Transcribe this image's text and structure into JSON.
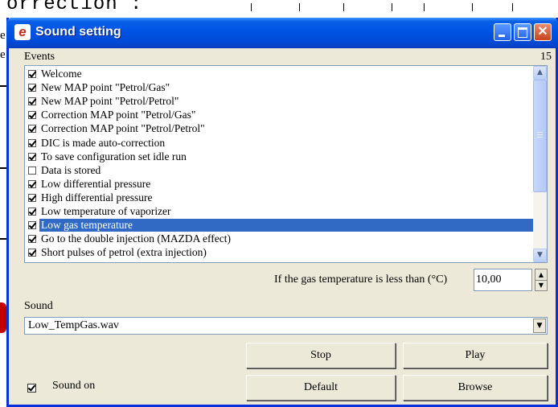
{
  "background": {
    "fragment_text": "orrection :",
    "left_letters": [
      "e",
      "e"
    ]
  },
  "window": {
    "title": "Sound setting",
    "app_icon_letter": "e",
    "controls": {
      "close_glyph": "✕"
    }
  },
  "events": {
    "label": "Events",
    "count": "15",
    "items": [
      {
        "label": "Welcome",
        "checked": true
      },
      {
        "label": "New MAP point \"Petrol/Gas\"",
        "checked": true
      },
      {
        "label": "New MAP point \"Petrol/Petrol\"",
        "checked": true
      },
      {
        "label": "Correction MAP point \"Petrol/Gas\"",
        "checked": true
      },
      {
        "label": "Correction MAP point \"Petrol/Petrol\"",
        "checked": true
      },
      {
        "label": "DIC is made auto-correction",
        "checked": true
      },
      {
        "label": "To save configuration set idle run",
        "checked": true
      },
      {
        "label": "Data is stored",
        "checked": false
      },
      {
        "label": "Low differential pressure",
        "checked": true
      },
      {
        "label": "High differential pressure",
        "checked": true
      },
      {
        "label": "Low temperature of vaporizer",
        "checked": true
      },
      {
        "label": "Low gas temperature",
        "checked": true,
        "selected": true
      },
      {
        "label": "Go to the double injection (MAZDA effect)",
        "checked": true
      },
      {
        "label": "Short pulses of petrol (extra injection)",
        "checked": true
      }
    ],
    "scroll_up_glyph": "▲",
    "scroll_down_glyph": "▼"
  },
  "condition": {
    "label": "If the gas temperature is less than (°C)",
    "value": "10,00",
    "spin_up": "▲",
    "spin_down": "▼"
  },
  "sound": {
    "label": "Sound",
    "selected_file": "Low_TempGas.wav",
    "dropdown_glyph": "▼"
  },
  "buttons": {
    "stop": "Stop",
    "play": "Play",
    "default": "Default",
    "browse": "Browse"
  },
  "sound_on": {
    "label": "Sound on",
    "checked": true
  },
  "colors": {
    "title_bar": "#0055e5",
    "selection": "#316ac5",
    "window_bg": "#ece9d8"
  }
}
